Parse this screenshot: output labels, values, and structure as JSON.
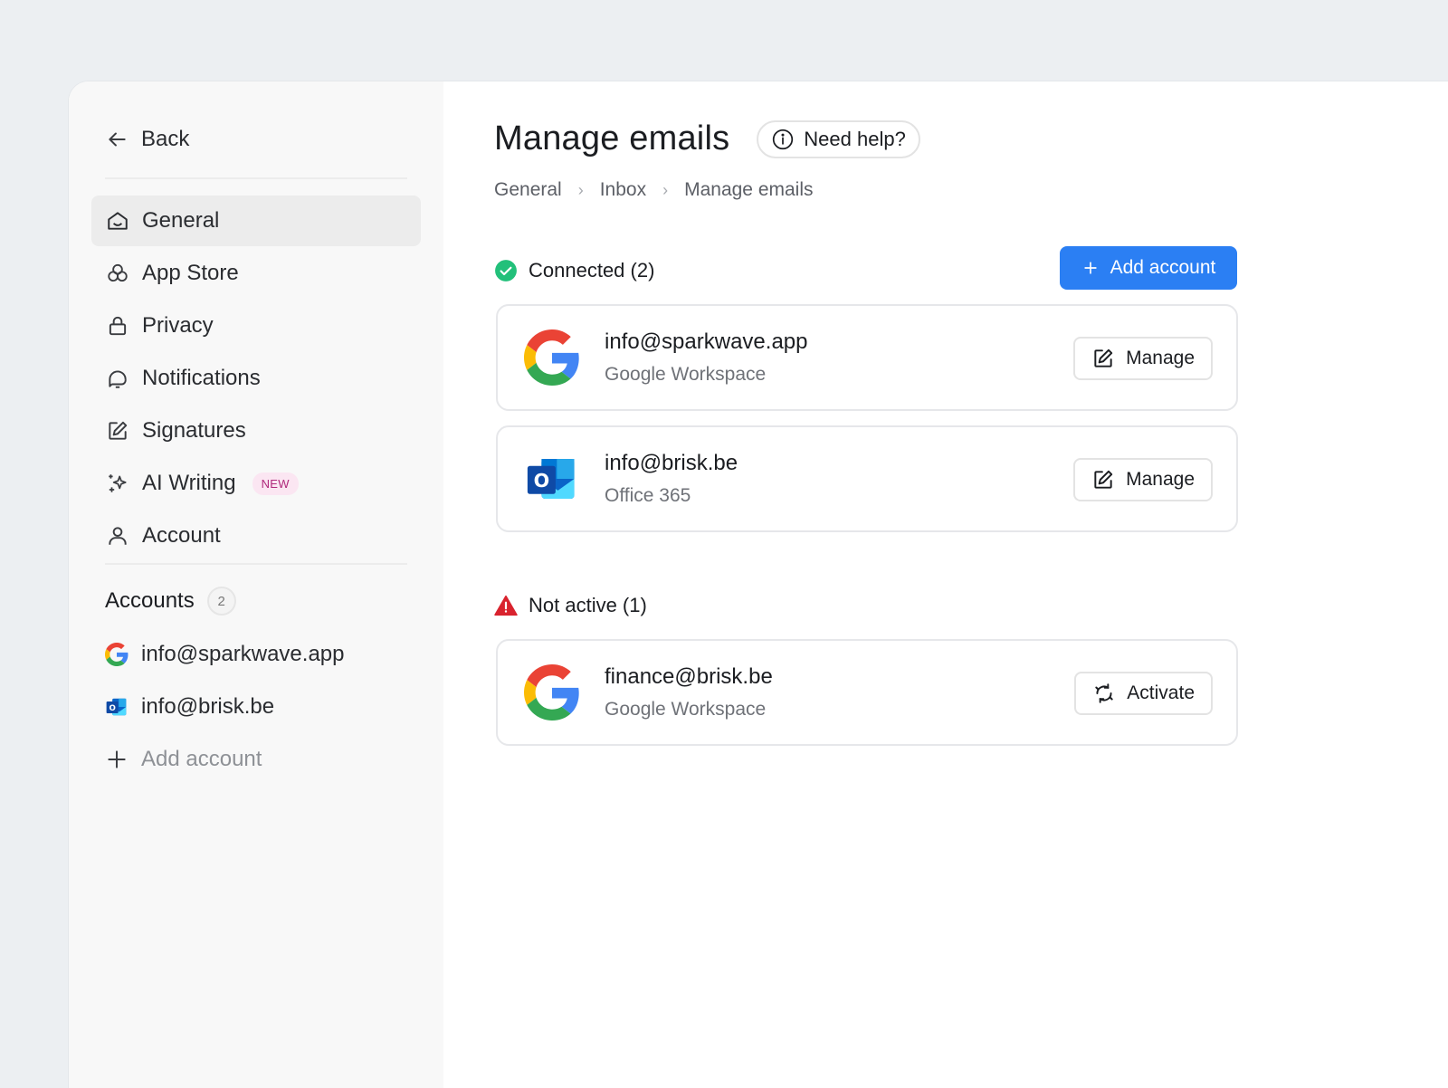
{
  "sidebar": {
    "back_label": "Back",
    "nav": [
      {
        "label": "General",
        "icon": "home-icon",
        "active": true
      },
      {
        "label": "App Store",
        "icon": "apps-icon"
      },
      {
        "label": "Privacy",
        "icon": "lock-icon"
      },
      {
        "label": "Notifications",
        "icon": "bell-icon"
      },
      {
        "label": "Signatures",
        "icon": "edit-icon"
      },
      {
        "label": "AI Writing",
        "icon": "sparkles-icon",
        "badge": "NEW"
      },
      {
        "label": "Account",
        "icon": "user-icon"
      }
    ],
    "accounts_title": "Accounts",
    "accounts_count": "2",
    "accounts": [
      {
        "email": "info@sparkwave.app",
        "icon": "google-icon"
      },
      {
        "email": "info@brisk.be",
        "icon": "outlook-icon"
      }
    ],
    "add_account_label": "Add account"
  },
  "main": {
    "title": "Manage emails",
    "help_label": "Need help?",
    "breadcrumb": [
      "General",
      "Inbox",
      "Manage emails"
    ],
    "connected_label": "Connected (2)",
    "add_account_button": "Add account",
    "connected": [
      {
        "email": "info@sparkwave.app",
        "provider": "Google Workspace",
        "action": "Manage",
        "logo": "google-logo"
      },
      {
        "email": "info@brisk.be",
        "provider": "Office 365",
        "action": "Manage",
        "logo": "outlook-logo"
      }
    ],
    "inactive_label": "Not active (1)",
    "inactive": [
      {
        "email": "finance@brisk.be",
        "provider": "Google Workspace",
        "action": "Activate",
        "logo": "google-logo"
      }
    ]
  },
  "colors": {
    "accent": "#2b7ff3",
    "connected_status": "#22c07a",
    "warning_status": "#d9232e",
    "new_badge_text": "#b0297c",
    "new_badge_bg": "#fbe6f2"
  }
}
